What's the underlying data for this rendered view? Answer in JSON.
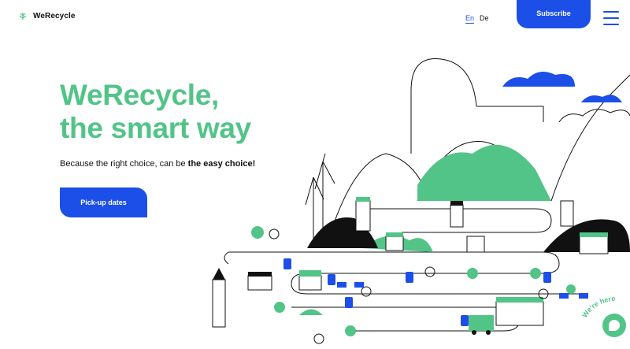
{
  "header": {
    "logo_text": "WeRecycle",
    "lang_en": "En",
    "lang_de": "De",
    "subscribe_label": "Subscribe"
  },
  "hero": {
    "title_line1": "WeRecycle,",
    "title_line2": "the smart way",
    "tagline_prefix": "Because the right choice, can be ",
    "tagline_bold": "the easy choice!",
    "cta_label": "Pick-up dates"
  },
  "badge": {
    "text": "We're here"
  },
  "colors": {
    "green": "#52c488",
    "blue": "#1c4fe8",
    "ink": "#111111"
  }
}
